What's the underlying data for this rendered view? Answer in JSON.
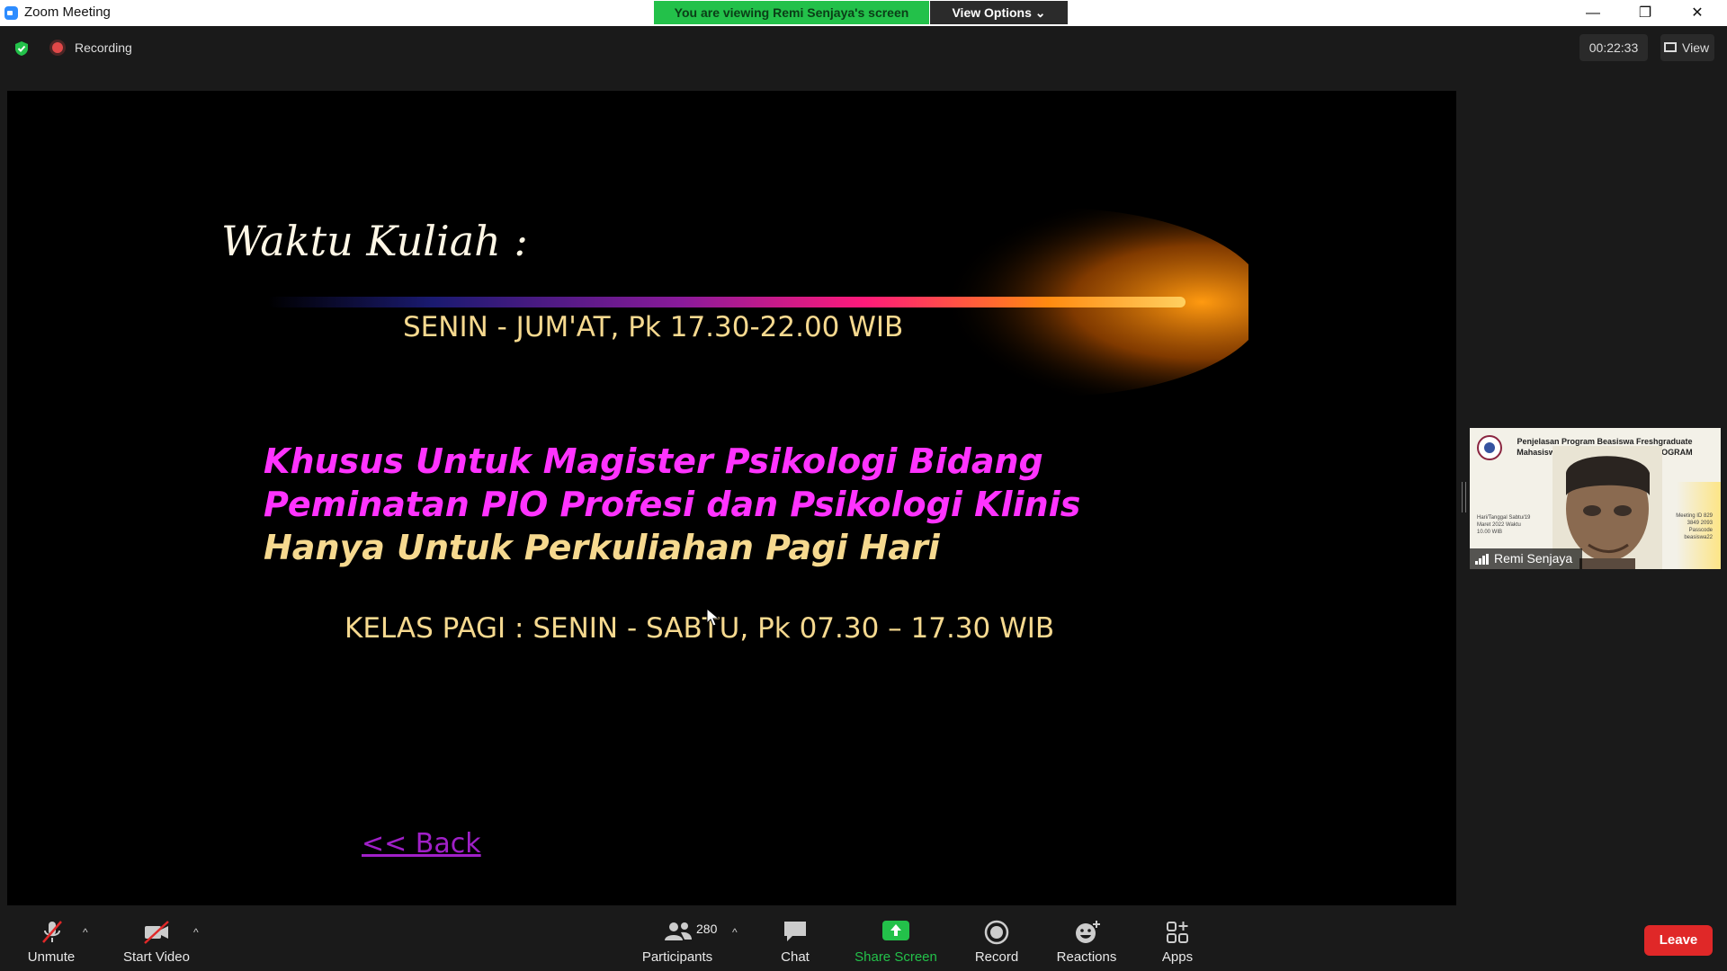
{
  "window": {
    "title": "Zoom Meeting",
    "banner": "You are viewing Remi Senjaya's screen",
    "view_options": "View Options",
    "chevron": "⌄",
    "min": "—",
    "max": "❐",
    "close": "✕"
  },
  "topbar": {
    "recording_label": "Recording",
    "timer": "00:22:33",
    "view_label": "View"
  },
  "slide": {
    "title": "Waktu Kuliah :",
    "schedule_evening": "SENIN - JUM'AT, Pk  17.30-22.00  WIB",
    "note_line1": "Khusus Untuk Magister Psikologi  Bidang",
    "note_line2": "Peminatan PIO Profesi dan Psikologi Klinis",
    "note_line3": "Hanya Untuk Perkuliahan Pagi Hari",
    "schedule_morning": "KELAS PAGI :   SENIN - SABTU, Pk 07.30 – 17.30 WIB",
    "back_link": "<< Back"
  },
  "participant_tile": {
    "name": "Remi Senjaya",
    "headline": "Penjelasan Program Beasiswa Freshgraduate Mahasiswa Alumni Angkatan 2017 PROGRAM MAGISTER ... DHARMA",
    "small_left": "Hari/Tanggal Sabtu/19 Maret 2022 Waktu 10.00 WIB",
    "small_right": "Meeting ID 829 3849 2093 Passcode beasiswa22"
  },
  "toolbar": {
    "unmute": "Unmute",
    "start_video": "Start Video",
    "participants": "Participants",
    "participant_count": "280",
    "chat": "Chat",
    "share_screen": "Share Screen",
    "record": "Record",
    "reactions": "Reactions",
    "apps": "Apps",
    "leave": "Leave",
    "caret": "^"
  },
  "colors": {
    "banner_green": "#23c14a",
    "leave_red": "#e02828",
    "slide_magenta": "#ff33ff",
    "slide_gold": "#f6d98f",
    "share_green": "#23c14a"
  }
}
